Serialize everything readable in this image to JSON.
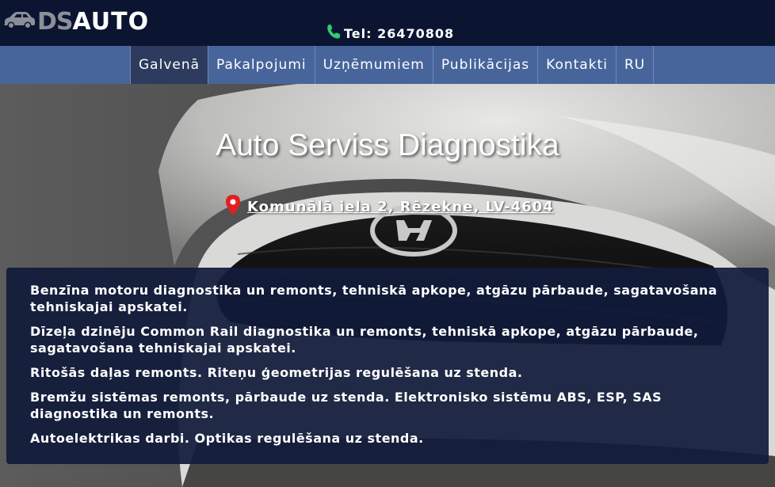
{
  "brand": {
    "logo_ds": "DS",
    "logo_auto": "AUTO"
  },
  "contact": {
    "phone": "Tel: 26470808"
  },
  "nav": {
    "items": [
      {
        "label": "Galvenā",
        "active": true
      },
      {
        "label": "Pakalpojumi",
        "active": false
      },
      {
        "label": "Uzņēmumiem",
        "active": false
      },
      {
        "label": "Publikācijas",
        "active": false
      },
      {
        "label": "Kontakti",
        "active": false
      },
      {
        "label": "RU",
        "active": false
      }
    ]
  },
  "hero": {
    "title": "Auto Serviss Diagnostika",
    "address": "Komunālā iela 2, Rēzekne, LV-4604"
  },
  "services": [
    "Benzīna motoru diagnostika un remonts, tehniskā apkope, atgāzu pārbaude, sagatavošana tehniskajai apskatei.",
    "Dīzeļa dzinēju Common Rail diagnostika un remonts, tehniskā apkope, atgāzu pārbaude, sagatavošana tehniskajai apskatei.",
    "Ritošās daļas remonts. Riteņu ģeometrijas regulēšana uz stenda.",
    "Bremžu sistēmas remonts, pārbaude uz stenda. Elektronisko sistēmu ABS, ESP, SAS diagnostika un remonts.",
    "Autoelektrikas darbi. Optikas regulēšana uz stenda."
  ],
  "colors": {
    "header_bg": "#0b1532",
    "nav_bg": "#47659b",
    "nav_active_bg": "#2c3b5e",
    "panel_bg": "#111b3a",
    "phone_icon": "#2ecc71",
    "pin_icon": "#e02020"
  }
}
